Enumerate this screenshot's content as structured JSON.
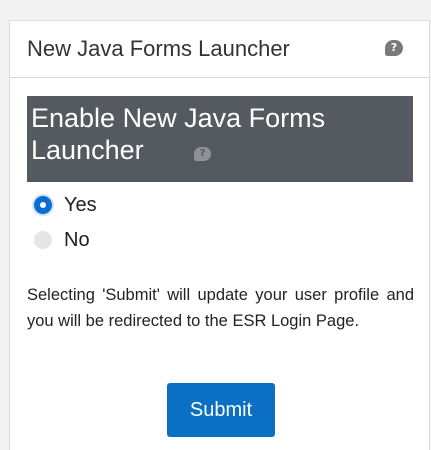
{
  "panel": {
    "title": "New Java Forms Launcher",
    "help_icon": "question-bubble-icon",
    "help_glyph": "?"
  },
  "section": {
    "title": "Enable New Java Forms Launcher",
    "help_icon": "question-bubble-icon",
    "help_glyph": "?"
  },
  "options": {
    "yes_label": "Yes",
    "no_label": "No",
    "selected": "Yes"
  },
  "info_text": "Selecting 'Submit' will update your user profile and you will be redirected to the ESR Login Page.",
  "submit_label": "Submit",
  "colors": {
    "banner": "#555a61",
    "accent": "#0b6fc4"
  }
}
